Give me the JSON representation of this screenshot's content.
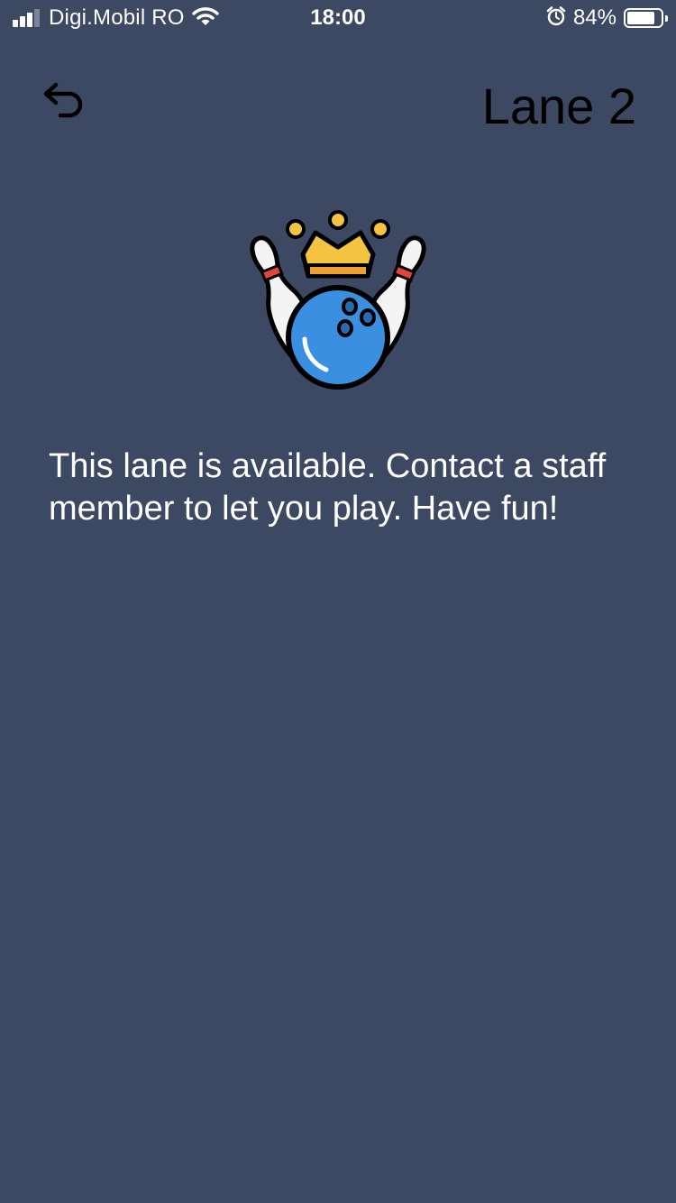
{
  "status_bar": {
    "carrier": "Digi.Mobil RO",
    "time": "18:00",
    "battery_percent": "84%",
    "battery_level": 0.84,
    "signal_bars_active": 3,
    "signal_bars_total": 4,
    "icons": [
      "signal-icon",
      "wifi-icon",
      "alarm-icon",
      "battery-icon"
    ]
  },
  "header": {
    "back_icon": "undo-arrow-icon",
    "title": "Lane 2"
  },
  "illustration": {
    "icon": "bowling-crown-icon",
    "colors": {
      "crown": "#f5c342",
      "ball": "#3b8fe0",
      "pin": "#f4f4f4",
      "pin_stripe": "#e0443a",
      "outline": "#000000"
    }
  },
  "main": {
    "message": "This lane is available. Contact a staff member to let you play. Have fun!"
  },
  "theme": {
    "background": "#3d4863",
    "text": "#ffffff",
    "title_text": "#000000"
  }
}
